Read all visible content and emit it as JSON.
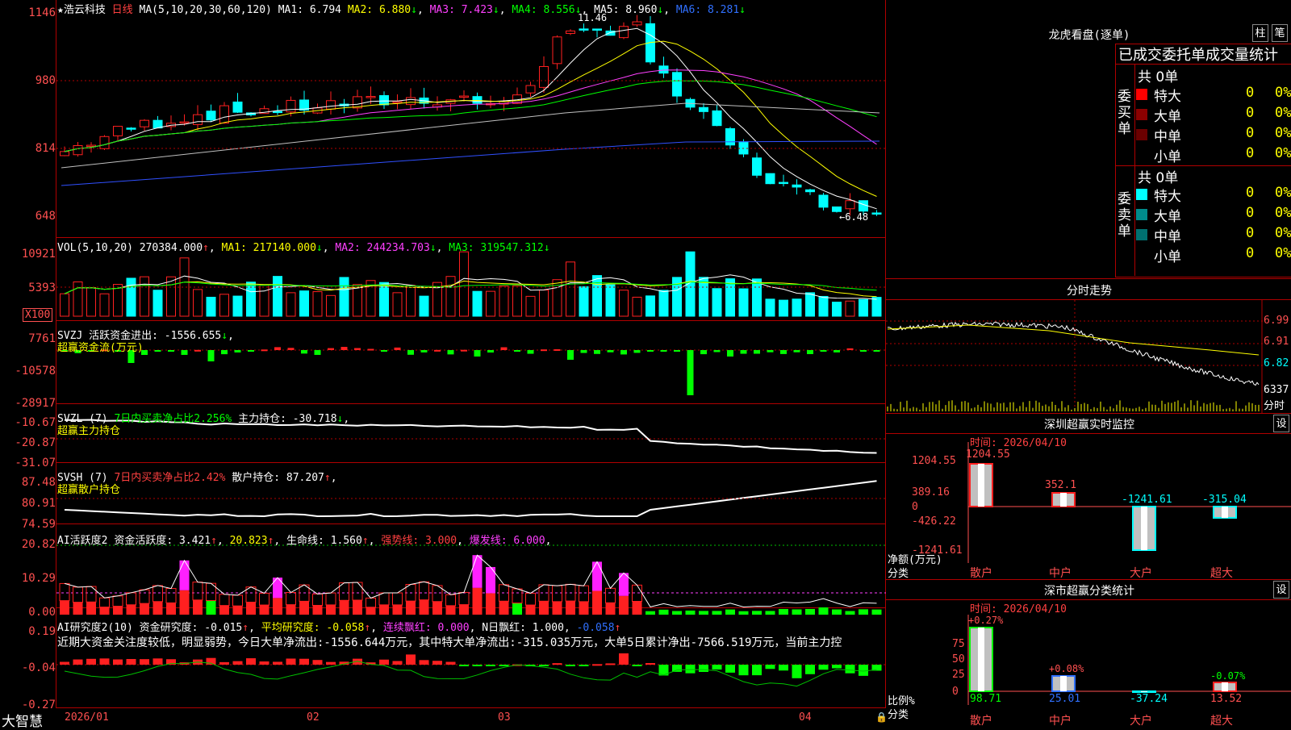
{
  "colors": {
    "bg": "#000000",
    "up": "#ff2020",
    "down": "#00ffff",
    "grid": "#b00000",
    "axis": "#ff5050"
  },
  "kline": {
    "stock_name": "浩云科技",
    "period": "日线",
    "ma_def": "MA(5,10,20,30,60,120)",
    "ma1": "MA1: 6.794",
    "ma2": "MA2: 6.880",
    "ma3": "MA3: 7.423",
    "ma4": "MA4: 8.556",
    "ma5": "MA5: 8.960",
    "ma6": "MA6: 8.281",
    "y_labels": [
      "1146",
      "980",
      "814",
      "648"
    ],
    "high_mark": "11.46",
    "low_mark": "←6.48"
  },
  "volume": {
    "def": "VOL(5,10,20)",
    "val": "270384.000",
    "ma1": "MA1: 217140.000",
    "ma2": "MA2: 244234.703",
    "ma3": "MA3: 319547.312",
    "y_labels": [
      "10921",
      "5393"
    ],
    "unit": "X100"
  },
  "svzj": {
    "def": "SVZJ",
    "name": "活跃资金进出: -1556.655",
    "sub": "超赢资金流(万元)",
    "y_labels": [
      "7761",
      "-10578",
      "-28917"
    ]
  },
  "svzl": {
    "def": "SVZL (7)",
    "ratio": "7日内买卖净占比2.256%",
    "main": "主力持仓: -30.718",
    "sub": "超赢主力持仓",
    "y_labels": [
      "-10.67",
      "-20.87",
      "-31.07"
    ]
  },
  "svsh": {
    "def": "SVSH (7)",
    "ratio": "7日内买卖净占比2.42%",
    "retail": "散户持仓: 87.207",
    "sub": "超赢散户持仓",
    "y_labels": [
      "87.48",
      "80.91",
      "74.59"
    ]
  },
  "ai_active": {
    "def": "AI活跃度2",
    "fund": "资金活跃度: 3.421",
    "v2": "20.823",
    "life": "生命线: 1.560",
    "strong": "强势线: 3.000",
    "burst": "爆发线: 6.000",
    "y_labels": [
      "20.82",
      "10.29",
      "0.00"
    ]
  },
  "ai_research": {
    "def": "AI研究度2(10)",
    "fund": "资金研究度: -0.015",
    "avg": "平均研究度: -0.058",
    "red": "连续飘红: 0.000",
    "n_red": "N日飘红: 1.000",
    "last": "-0.058",
    "comment": "近期大资金关注度较低，明显弱势，今日大单净流出:-1556.644万元，其中特大单净流出:-315.035万元，大单5日累计净出-7566.519万元，当前主力控",
    "y_labels": [
      "0.19",
      "-0.04",
      "-0.27"
    ]
  },
  "xaxis": {
    "brand": "大智慧",
    "dates": [
      "2026/01",
      "02",
      "03",
      "04"
    ]
  },
  "right": {
    "lhb_title": "龙虎看盘(逐单)",
    "btn1": "柱",
    "btn2": "笔",
    "stats_title": "已成交委托单成交量统计",
    "buy": {
      "label": "委买单",
      "total": "共 0单",
      "rows": [
        {
          "name": "特大",
          "val": "0",
          "pct": "0%",
          "color": "#ff0000"
        },
        {
          "name": "大单",
          "val": "0",
          "pct": "0%",
          "color": "#8b0000"
        },
        {
          "name": "中单",
          "val": "0",
          "pct": "0%",
          "color": "#6b0000"
        },
        {
          "name": "小单",
          "val": "0",
          "pct": "0%",
          "color": ""
        }
      ]
    },
    "sell": {
      "label": "委卖单",
      "total": "共 0单",
      "rows": [
        {
          "name": "特大",
          "val": "0",
          "pct": "0%",
          "color": "#00ffff"
        },
        {
          "name": "大单",
          "val": "0",
          "pct": "0%",
          "color": "#008b8b"
        },
        {
          "name": "中单",
          "val": "0",
          "pct": "0%",
          "color": "#007070"
        },
        {
          "name": "小单",
          "val": "0",
          "pct": "0%",
          "color": ""
        }
      ]
    },
    "fs_title": "分时走势",
    "fs_prices": [
      "6.99",
      "6.91",
      "6.82"
    ],
    "fs_vol": "6337",
    "fs_unit": "分时",
    "monitor": {
      "title": "深圳超赢实时监控",
      "btn": "设",
      "time": "时间: 2026/04/10",
      "y_labels": [
        "1204.55",
        "389.16",
        "0",
        "-426.22",
        "-1241.61"
      ],
      "yunit": "净额(万元)",
      "xunit": "分类",
      "cats": [
        "散户",
        "中户",
        "大户",
        "超大"
      ],
      "vals": [
        "1204.55",
        "352.1",
        "-1241.61",
        "-315.04"
      ]
    },
    "classify": {
      "title": "深市超赢分类统计",
      "btn": "设",
      "time": "时间: 2026/04/10",
      "y_labels": [
        "75",
        "50",
        "25",
        "0"
      ],
      "yunit": "比例%",
      "xunit": "分类",
      "cats": [
        "散户",
        "中户",
        "大户",
        "超大"
      ],
      "pcts": [
        "+0.27%",
        "+0.08%",
        "-0.07%"
      ],
      "vals": [
        "98.71",
        "25.01",
        "-37.24",
        "13.52"
      ]
    }
  }
}
